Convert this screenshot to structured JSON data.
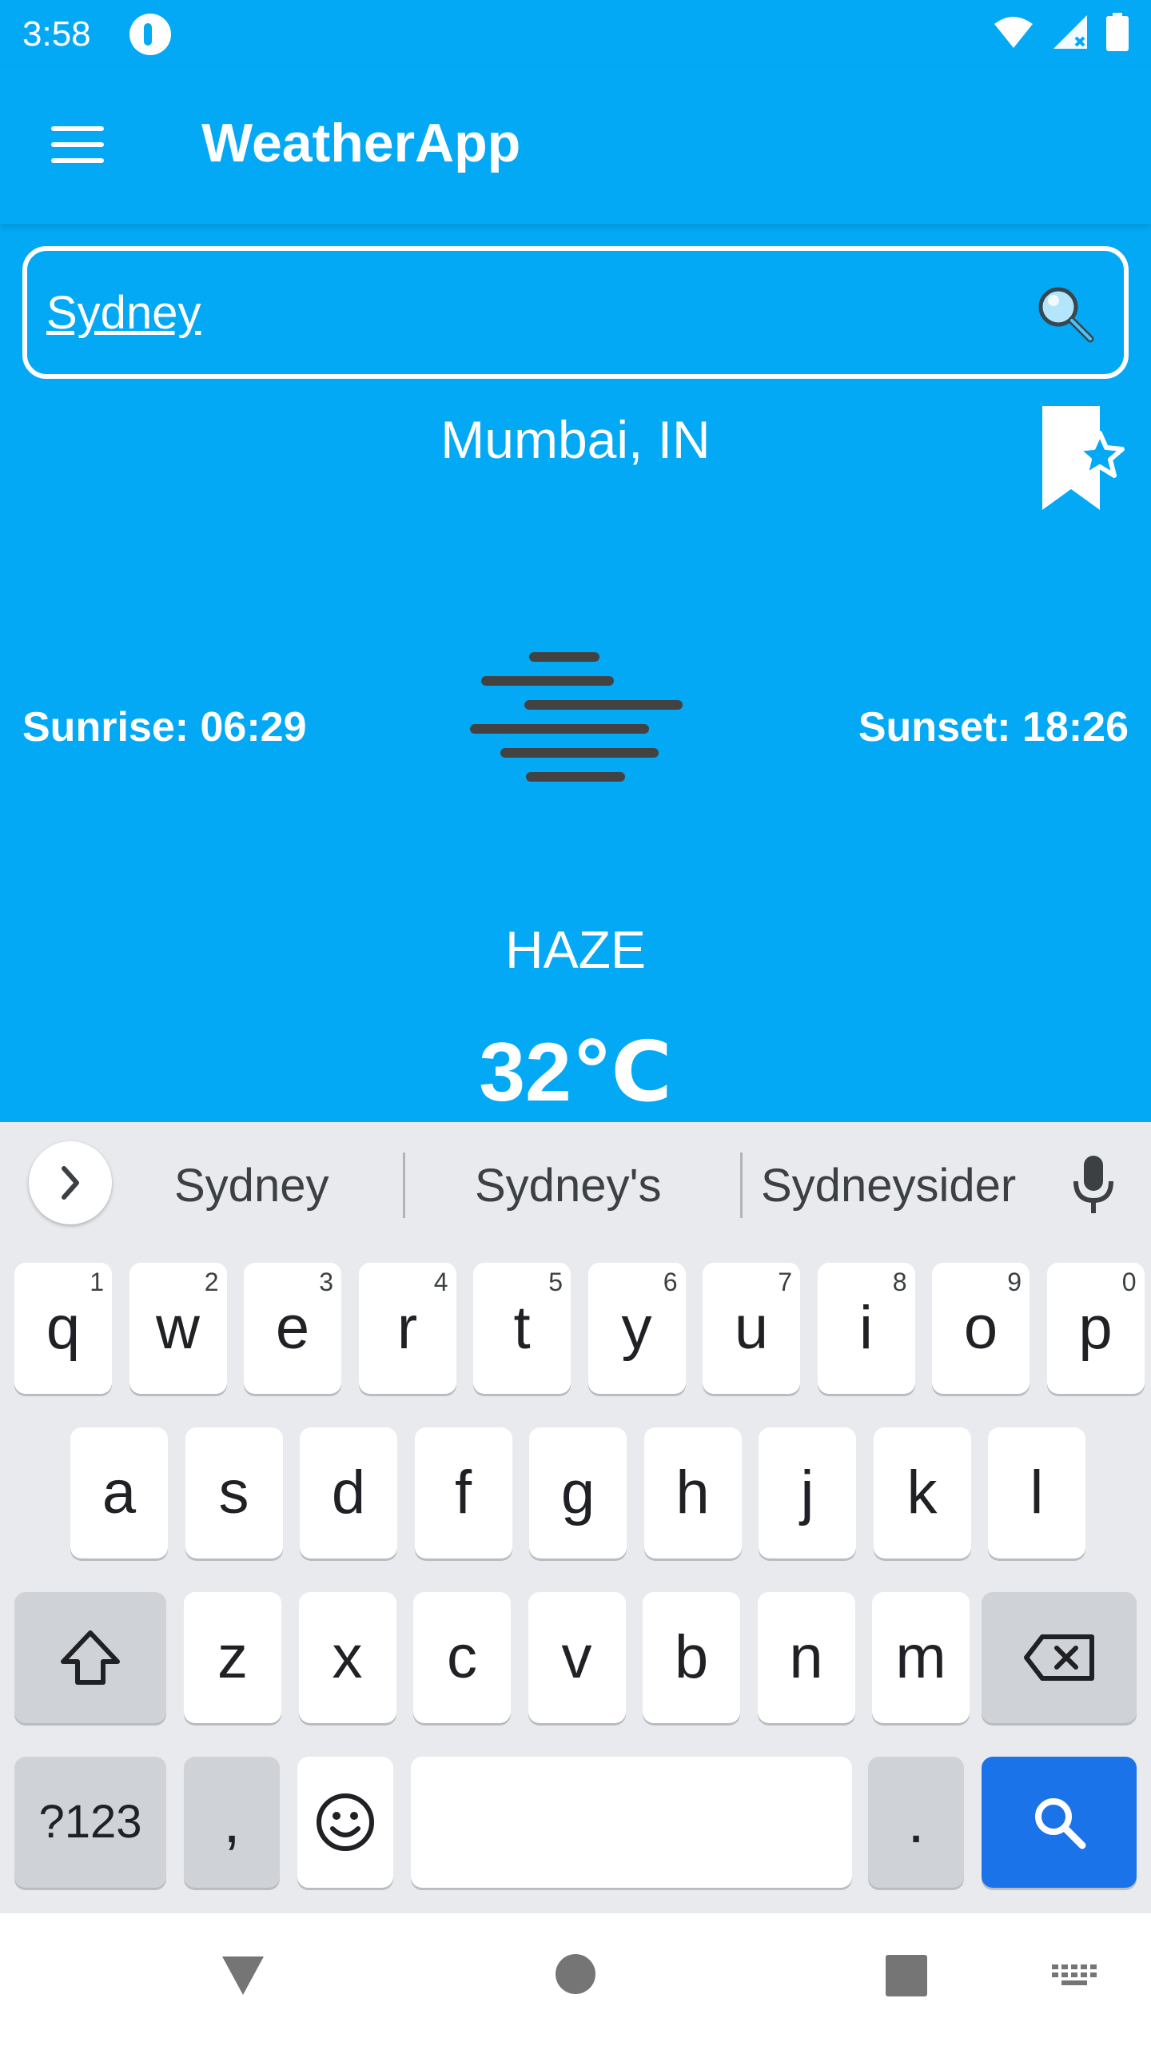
{
  "status_bar": {
    "time": "3:58"
  },
  "app_bar": {
    "title": "WeatherApp",
    "icons": [
      "menu-icon"
    ]
  },
  "search": {
    "value": "Sydney",
    "icon": "search-icon"
  },
  "weather": {
    "city": "Mumbai, IN",
    "sunrise": "Sunrise: 06:29",
    "sunset": "Sunset: 18:26",
    "condition": "HAZE",
    "temperature": "32℃",
    "icon": "haze-icon"
  },
  "keyboard": {
    "suggestions": [
      "Sydney",
      "Sydney's",
      "Sydneysider"
    ],
    "row1": [
      {
        "key": "q",
        "hint": "1"
      },
      {
        "key": "w",
        "hint": "2"
      },
      {
        "key": "e",
        "hint": "3"
      },
      {
        "key": "r",
        "hint": "4"
      },
      {
        "key": "t",
        "hint": "5"
      },
      {
        "key": "y",
        "hint": "6"
      },
      {
        "key": "u",
        "hint": "7"
      },
      {
        "key": "i",
        "hint": "8"
      },
      {
        "key": "o",
        "hint": "9"
      },
      {
        "key": "p",
        "hint": "0"
      }
    ],
    "row2": [
      "a",
      "s",
      "d",
      "f",
      "g",
      "h",
      "j",
      "k",
      "l"
    ],
    "row3": [
      "z",
      "x",
      "c",
      "v",
      "b",
      "n",
      "m"
    ],
    "symbols_label": "?123",
    "comma_label": ",",
    "period_label": ".",
    "action_color": "#1a73e8"
  },
  "colors": {
    "primary": "#03a9f4",
    "keyboard_bg": "#e8eaed"
  }
}
